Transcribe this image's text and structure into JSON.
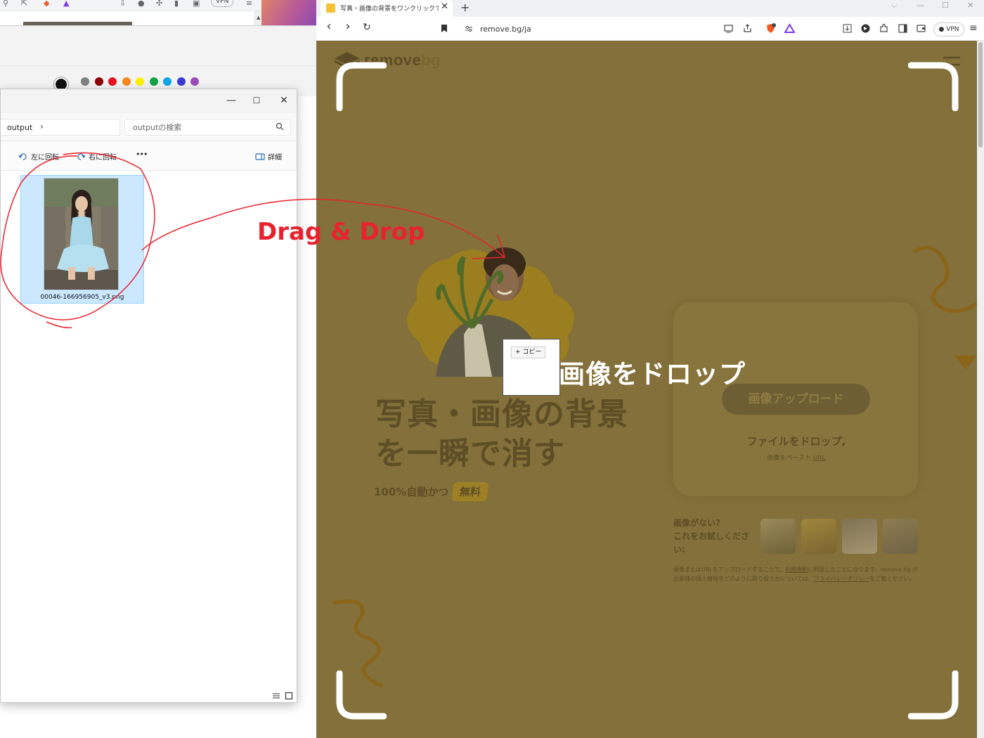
{
  "left_window": {
    "top_vpn": "VPN",
    "scroll_arrow": "▲",
    "paint_colors": [
      "#111111",
      "#808080",
      "#8b0000",
      "#e81123",
      "#f7881b",
      "#fff100",
      "#16a34a",
      "#0ea5e9",
      "#3b3bd6",
      "#9b4cb8"
    ]
  },
  "explorer": {
    "title_controls": {
      "minimize": "—",
      "maximize": "☐",
      "close": "✕"
    },
    "breadcrumb": "output",
    "breadcrumb_chevron": "›",
    "search_placeholder": "outputの検索",
    "commands": {
      "rotate_left": "左に回転",
      "rotate_right": "右に回転",
      "more": "•••",
      "details": "詳細"
    },
    "file_name": "00046-166956905_v3.png"
  },
  "browser": {
    "tab_title": "写真・画像の背景をワンクリックで消",
    "tab_close": "✕",
    "new_tab": "+",
    "window_controls": {
      "dropdown": "⌵",
      "minimize": "—",
      "maximize": "☐",
      "close": "✕"
    },
    "nav": {
      "back": "‹",
      "forward": "›",
      "reload": "↻"
    },
    "url": "remove.bg/ja",
    "vpn_label": "VPN",
    "menu": "≡"
  },
  "page": {
    "logo": {
      "part1": "remove",
      "part2": "bg"
    },
    "headline_line1": "写真・画像の背景",
    "headline_line2": "を一瞬で消す",
    "subline": "100%自動かつ",
    "free_badge": "無料",
    "upload_button": "画像アップロード",
    "drop_file_text": "ファイルをドロップ,",
    "paste_text": "画像をペースト",
    "paste_link": "URL",
    "no_image_line1": "画像がない?",
    "no_image_line2": "これをお試しくださ",
    "no_image_line3": "い:",
    "terms_prefix": "画像またはURLをアップロードすることで、",
    "terms_link1": "利用規約",
    "terms_mid": "に同意したことになります。remove.bg がお客様の個人情報をどのように取り扱うかについては、",
    "terms_link2": "プライバシーポリシー",
    "terms_suffix": "をご覧ください。",
    "drop_overlay_title": "画像をドロップ"
  },
  "drag": {
    "copy_label": "+ コピー"
  },
  "annotation": {
    "text": "Drag & Drop",
    "color": "#e8232f"
  },
  "colors": {
    "overlay_brown": "#83703a",
    "selection_blue": "#cce8ff",
    "brand_yellow": "#f3c337"
  }
}
